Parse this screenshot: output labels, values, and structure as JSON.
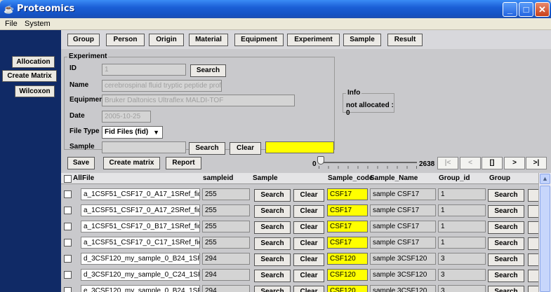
{
  "window": {
    "title": "Proteomics"
  },
  "menu": [
    "File",
    "System"
  ],
  "left_nav": [
    "Allocation",
    "Create Matrix",
    "Wilcoxon"
  ],
  "toolbar": [
    "Group",
    "Person",
    "Origin",
    "Material",
    "Equipment",
    "Experiment",
    "Sample",
    "Result"
  ],
  "experiment": {
    "legend": "Experiment",
    "id_label": "ID",
    "id_value": "1",
    "id_search": "Search",
    "name_label": "Name",
    "name_value": "cerebrospinal fluid tryptic peptide profiles",
    "equipment_label": "Equipment",
    "equipment_value": "Bruker Daltonics Ultraflex MALDI-TOF",
    "date_label": "Date",
    "date_value": "2005-10-25",
    "filetype_label": "File Type",
    "filetype_value": "Fid Files (fid)",
    "sample_label": "Sample",
    "sample_value": "",
    "sample_search": "Search",
    "sample_clear": "Clear"
  },
  "info": {
    "legend": "Info",
    "text": "not allocated : 0"
  },
  "actions": {
    "save": "Save",
    "create_matrix": "Create matrix",
    "report": "Report"
  },
  "slider": {
    "min": "0",
    "max": "2638",
    "value": 0
  },
  "nav": [
    "|<",
    "<",
    "[]",
    ">",
    ">|"
  ],
  "table": {
    "headers": {
      "all": "All",
      "file": "File",
      "sampleid": "sampleid",
      "sample": "Sample",
      "sample_code": "Sample_code",
      "sample_name": "Sample_Name",
      "group_id": "Group_id",
      "group": "Group"
    },
    "search_label": "Search",
    "clear_label": "Clear",
    "rows": [
      {
        "file": "a_1CSF51_CSF17_0_A17_1SRef_fid",
        "sampleid": "255",
        "sample_code": "CSF17",
        "sample_name": "sample CSF17",
        "group_id": "1"
      },
      {
        "file": "a_1CSF51_CSF17_0_A17_2SRef_fid",
        "sampleid": "255",
        "sample_code": "CSF17",
        "sample_name": "sample CSF17",
        "group_id": "1"
      },
      {
        "file": "a_1CSF51_CSF17_0_B17_1SRef_fid",
        "sampleid": "255",
        "sample_code": "CSF17",
        "sample_name": "sample CSF17",
        "group_id": "1"
      },
      {
        "file": "a_1CSF51_CSF17_0_C17_1SRef_fid",
        "sampleid": "255",
        "sample_code": "CSF17",
        "sample_name": "sample CSF17",
        "group_id": "1"
      },
      {
        "file": "d_3CSF120_my_sample_0_B24_1SRef_",
        "sampleid": "294",
        "sample_code": "CSF120",
        "sample_name": "sample 3CSF120",
        "group_id": "3"
      },
      {
        "file": "d_3CSF120_my_sample_0_C24_1SRef_",
        "sampleid": "294",
        "sample_code": "CSF120",
        "sample_name": "sample 3CSF120",
        "group_id": "3"
      },
      {
        "file": "e_3CSF120_my_sample_0_B24_1SRef_",
        "sampleid": "294",
        "sample_code": "CSF120",
        "sample_name": "sample 3CSF120",
        "group_id": "3"
      }
    ]
  },
  "colors": {
    "title_bar": "#1b5fd6",
    "left_panel": "#102a66",
    "highlight": "#ffff00"
  }
}
